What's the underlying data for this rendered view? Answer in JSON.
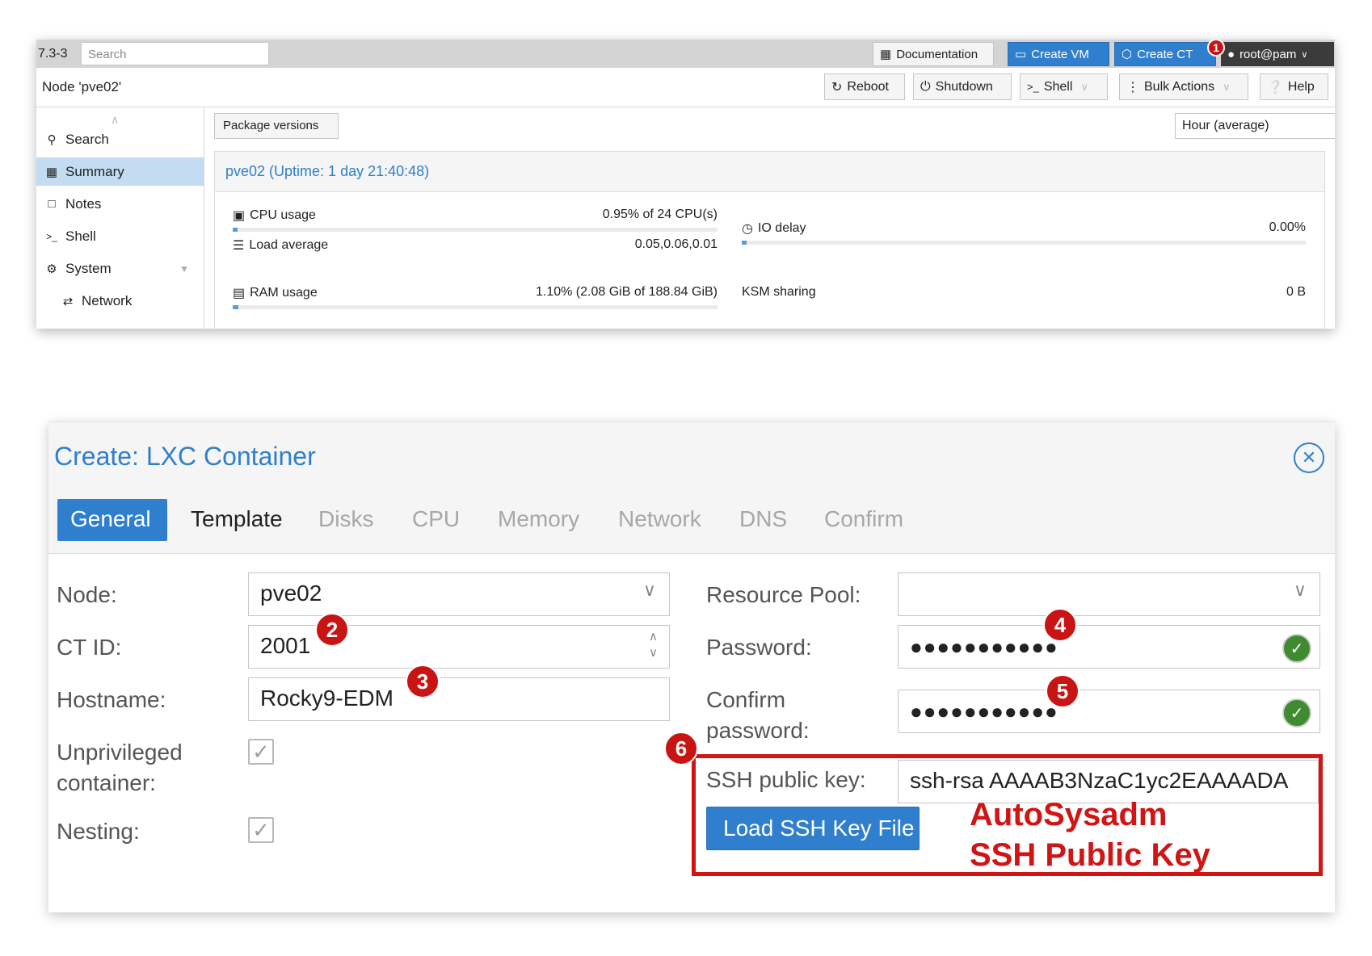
{
  "topbar": {
    "version": "7.3-3",
    "search_placeholder": "Search",
    "buttons": {
      "documentation": "Documentation",
      "create_vm": "Create VM",
      "create_ct": "Create CT",
      "user": "root@pam"
    },
    "marker": "1"
  },
  "nodebar": {
    "title": "Node 'pve02'",
    "buttons": {
      "reboot": "Reboot",
      "shutdown": "Shutdown",
      "shell": "Shell",
      "bulk_actions": "Bulk Actions",
      "help": "Help"
    }
  },
  "sidebar": {
    "items": [
      {
        "label": "Search",
        "icon": "search-icon"
      },
      {
        "label": "Summary",
        "icon": "book-icon",
        "active": true
      },
      {
        "label": "Notes",
        "icon": "note-icon"
      },
      {
        "label": "Shell",
        "icon": "terminal-icon"
      },
      {
        "label": "System",
        "icon": "gears-icon"
      },
      {
        "label": "Network",
        "icon": "exchange-icon"
      }
    ]
  },
  "summary": {
    "package_versions": "Package versions",
    "timeframe": "Hour (average)",
    "title": "pve02 (Uptime: 1 day 21:40:48)",
    "stats": {
      "cpu_label": "CPU usage",
      "cpu_value": "0.95% of 24 CPU(s)",
      "cpu_fraction": 0.0095,
      "load_label": "Load average",
      "load_value": "0.05,0.06,0.01",
      "io_label": "IO delay",
      "io_value": "0.00%",
      "io_fraction": 0.0,
      "ram_label": "RAM usage",
      "ram_value": "1.10% (2.08 GiB of 188.84 GiB)",
      "ram_fraction": 0.011,
      "ksm_label": "KSM sharing",
      "ksm_value": "0 B"
    }
  },
  "dialog": {
    "title": "Create: LXC Container",
    "tabs": [
      "General",
      "Template",
      "Disks",
      "CPU",
      "Memory",
      "Network",
      "DNS",
      "Confirm"
    ],
    "active_tab": "General",
    "fields": {
      "node_label": "Node:",
      "node_value": "pve02",
      "ctid_label": "CT ID:",
      "ctid_value": "2001",
      "hostname_label": "Hostname:",
      "hostname_value": "Rocky9-EDM",
      "unprivileged_label_1": "Unprivileged",
      "unprivileged_label_2": "container:",
      "unprivileged_checked": true,
      "nesting_label": "Nesting:",
      "nesting_checked": true,
      "pool_label": "Resource Pool:",
      "pool_value": "",
      "password_label": "Password:",
      "password_value": "●●●●●●●●●●●",
      "confirm_label_1": "Confirm",
      "confirm_label_2": "password:",
      "confirm_value": "●●●●●●●●●●●",
      "ssh_label": "SSH public key:",
      "ssh_value": "ssh-rsa AAAAB3NzaC1yc2EAAAADA",
      "load_key_button": "Load SSH Key File"
    },
    "markers": [
      "2",
      "3",
      "4",
      "5",
      "6"
    ],
    "annotation": {
      "line1": "AutoSysadm",
      "line2": "SSH Public Key",
      "color": "#d11414"
    }
  },
  "colors": {
    "accent": "#2f7fce",
    "annotation_red": "#d11414",
    "sidebar_active": "#c3dcf1"
  }
}
